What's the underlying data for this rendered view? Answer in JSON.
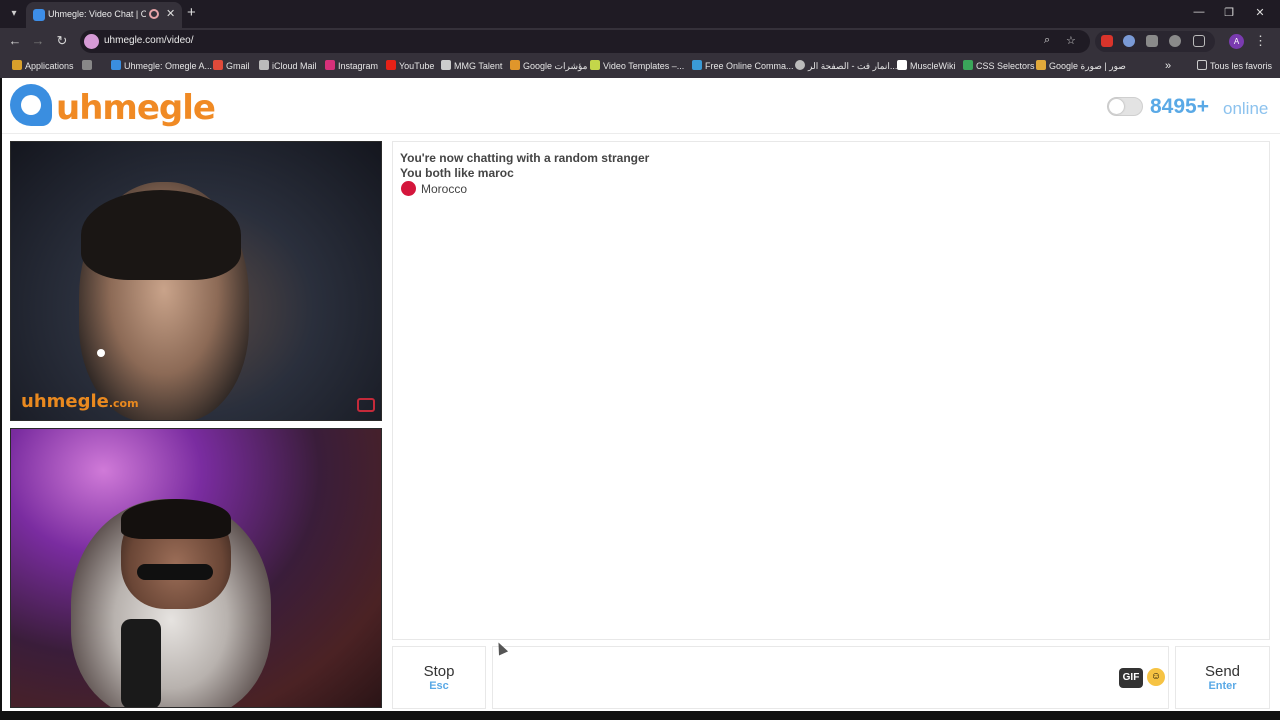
{
  "browser": {
    "tab_title": "Uhmegle: Video Chat | Ome",
    "url": "uhmegle.com/video/",
    "profile_initial": "A",
    "bookmarks": [
      {
        "label": "Applications",
        "icon": "apps-grid-icon"
      },
      {
        "label": "Uhmegle: Omegle A...",
        "icon": "uhmegle-favicon-icon"
      },
      {
        "label": "Gmail",
        "icon": "gmail-icon"
      },
      {
        "label": "iCloud Mail",
        "icon": "apple-icon"
      },
      {
        "label": "Instagram",
        "icon": "instagram-icon"
      },
      {
        "label": "YouTube",
        "icon": "youtube-icon"
      },
      {
        "label": "MMG Talent",
        "icon": "mmg-icon"
      },
      {
        "label": "Google مؤشرات",
        "icon": "trends-icon"
      },
      {
        "label": "Video Templates –...",
        "icon": "envato-icon"
      },
      {
        "label": "Free Online Comma...",
        "icon": "command-icon"
      },
      {
        "label": "انمار فت - الصفحة الر...",
        "icon": "globe-icon"
      },
      {
        "label": "MuscleWiki",
        "icon": "musclewiki-icon"
      },
      {
        "label": "CSS Selectors",
        "icon": "w3schools-icon"
      },
      {
        "label": "Google صور | صورة",
        "icon": "google-icon"
      },
      {
        "label": "Tous les favoris",
        "icon": "folder-icon"
      }
    ]
  },
  "site": {
    "logo_text": "uhmegle",
    "online_count": "8495+",
    "online_label": "online"
  },
  "video": {
    "watermark": "uhmegle",
    "watermark_suffix": ".com"
  },
  "chat": {
    "lines": [
      "You're now chatting with a random stranger",
      "You both like maroc"
    ],
    "country": "Morocco",
    "country_color": "#d4163c"
  },
  "controls": {
    "stop_label": "Stop",
    "stop_key": "Esc",
    "send_label": "Send",
    "send_key": "Enter",
    "gif_label": "GIF",
    "message_placeholder": ""
  },
  "colors": {
    "brand_orange": "#f08a24",
    "brand_blue": "#3a8ee0",
    "accent_blue": "#5aa9e6"
  }
}
